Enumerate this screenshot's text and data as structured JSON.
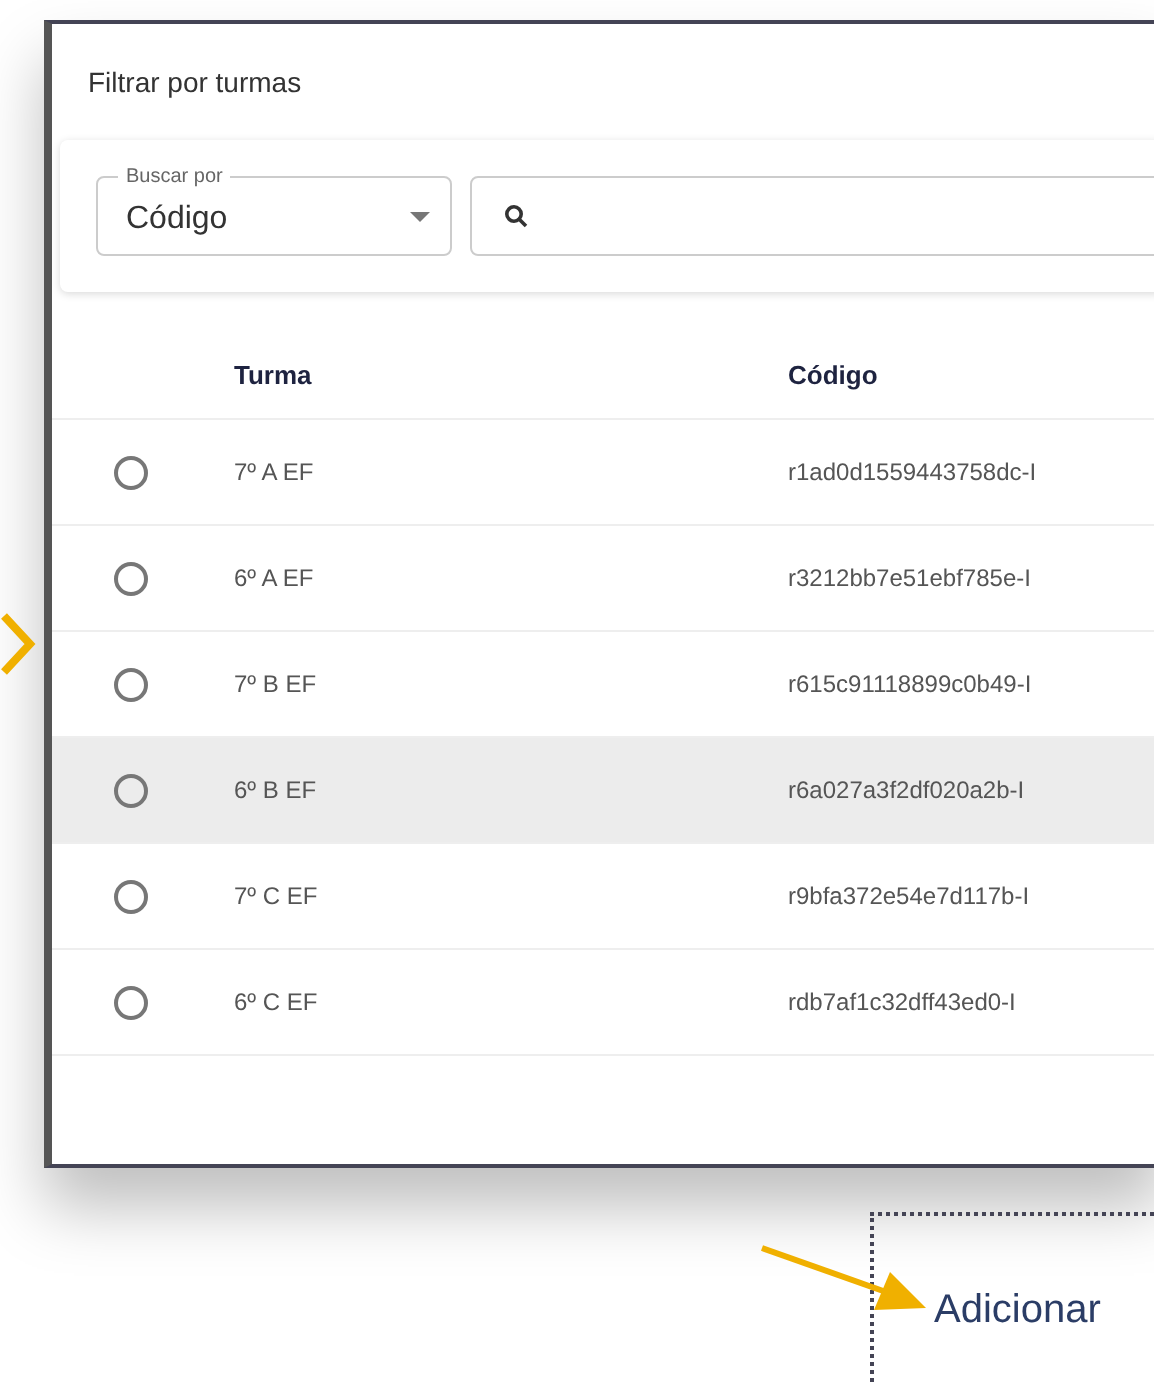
{
  "dialog": {
    "title": "Filtrar por turmas",
    "search_by": {
      "label": "Buscar por",
      "value": "Código"
    },
    "table": {
      "columns": [
        "Turma",
        "Código"
      ],
      "rows": [
        {
          "turma": "7º A EF",
          "codigo": "r1ad0d1559443758dc-I",
          "selected": false,
          "hovered": false
        },
        {
          "turma": "6º A EF",
          "codigo": "r3212bb7e51ebf785e-I",
          "selected": false,
          "hovered": false
        },
        {
          "turma": "7º B EF",
          "codigo": "r615c91118899c0b49-I",
          "selected": false,
          "hovered": false
        },
        {
          "turma": "6º B EF",
          "codigo": "r6a027a3f2df020a2b-I",
          "selected": false,
          "hovered": true
        },
        {
          "turma": "7º C EF",
          "codigo": "r9bfa372e54e7d117b-I",
          "selected": false,
          "hovered": false
        },
        {
          "turma": "6º C EF",
          "codigo": "rdb7af1c32dff43ed0-I",
          "selected": false,
          "hovered": false
        }
      ]
    }
  },
  "add_button": {
    "label": "Adicionar"
  }
}
